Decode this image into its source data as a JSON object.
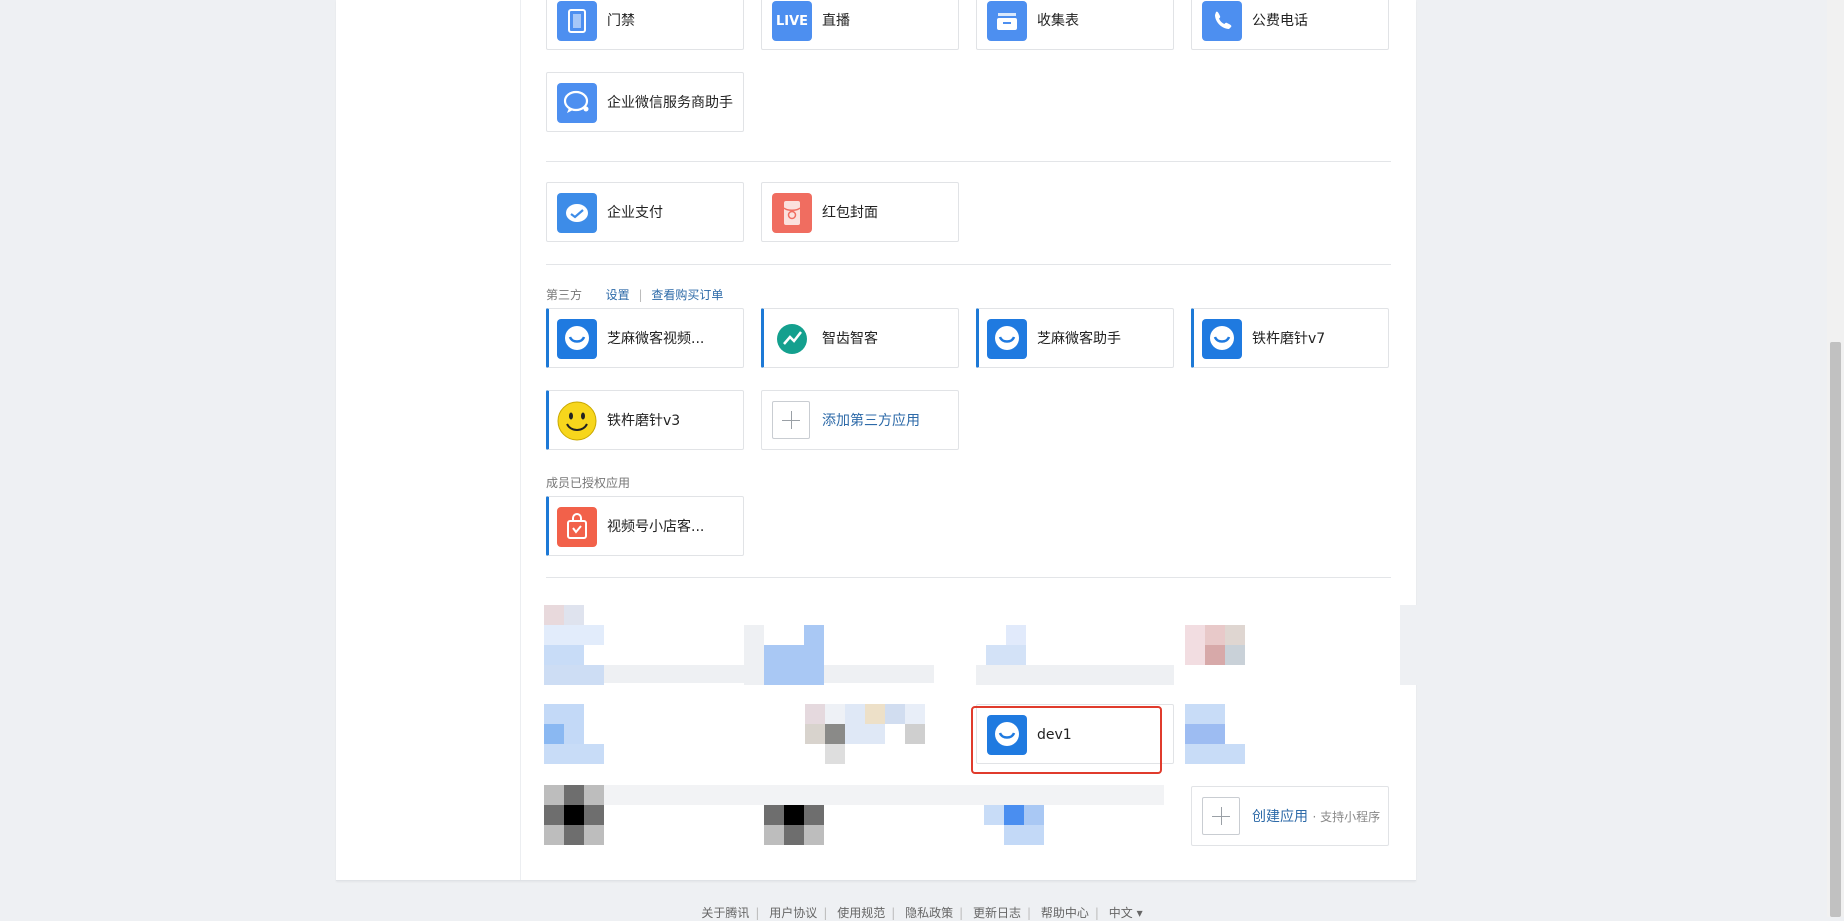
{
  "builtin_apps": [
    {
      "label": "门禁",
      "icon": "door-icon"
    },
    {
      "label": "直播",
      "icon": "live-icon",
      "badge": "LIVE"
    },
    {
      "label": "收集表",
      "icon": "inbox-icon"
    },
    {
      "label": "公费电话",
      "icon": "phone-icon"
    },
    {
      "label": "企业微信服务商助手",
      "icon": "chat-bubble-icon"
    }
  ],
  "payment_apps": [
    {
      "label": "企业支付",
      "icon": "payment-icon",
      "color": "#3d8ce8"
    },
    {
      "label": "红包封面",
      "icon": "red-envelope-icon",
      "color": "#f06d60"
    }
  ],
  "third_party": {
    "title": "第三方",
    "settings_link": "设置",
    "separator": "|",
    "orders_link": "查看购买订单",
    "apps": [
      {
        "label": "芝麻微客视频...",
        "icon": "smile-bubble-icon"
      },
      {
        "label": "智齿智客",
        "icon": "chart-leaf-icon"
      },
      {
        "label": "芝麻微客助手",
        "icon": "smile-bubble-icon"
      },
      {
        "label": "铁杵磨针v7",
        "icon": "smile-bubble-icon"
      },
      {
        "label": "铁杵磨针v3",
        "icon": "smiley-face-icon"
      }
    ],
    "add_label": "添加第三方应用"
  },
  "member_authorized": {
    "title": "成员已授权应用",
    "apps": [
      {
        "label": "视频号小店客...",
        "icon": "shop-bag-icon",
        "color": "#f2614a"
      }
    ]
  },
  "custom_apps": {
    "highlighted": {
      "label": "dev1",
      "icon": "smile-bubble-icon"
    },
    "create_label": "创建应用",
    "create_sub": "· 支持小程序"
  },
  "footer": {
    "links": [
      "关于腾讯",
      "用户协议",
      "使用规范",
      "隐私政策",
      "更新日志",
      "帮助中心"
    ],
    "language": "中文 ▾"
  },
  "colors": {
    "accent": "#1d79d6",
    "link": "#2d6aa8",
    "icon_blue": "#4d8ff0",
    "highlight_frame": "#e03b2c"
  }
}
